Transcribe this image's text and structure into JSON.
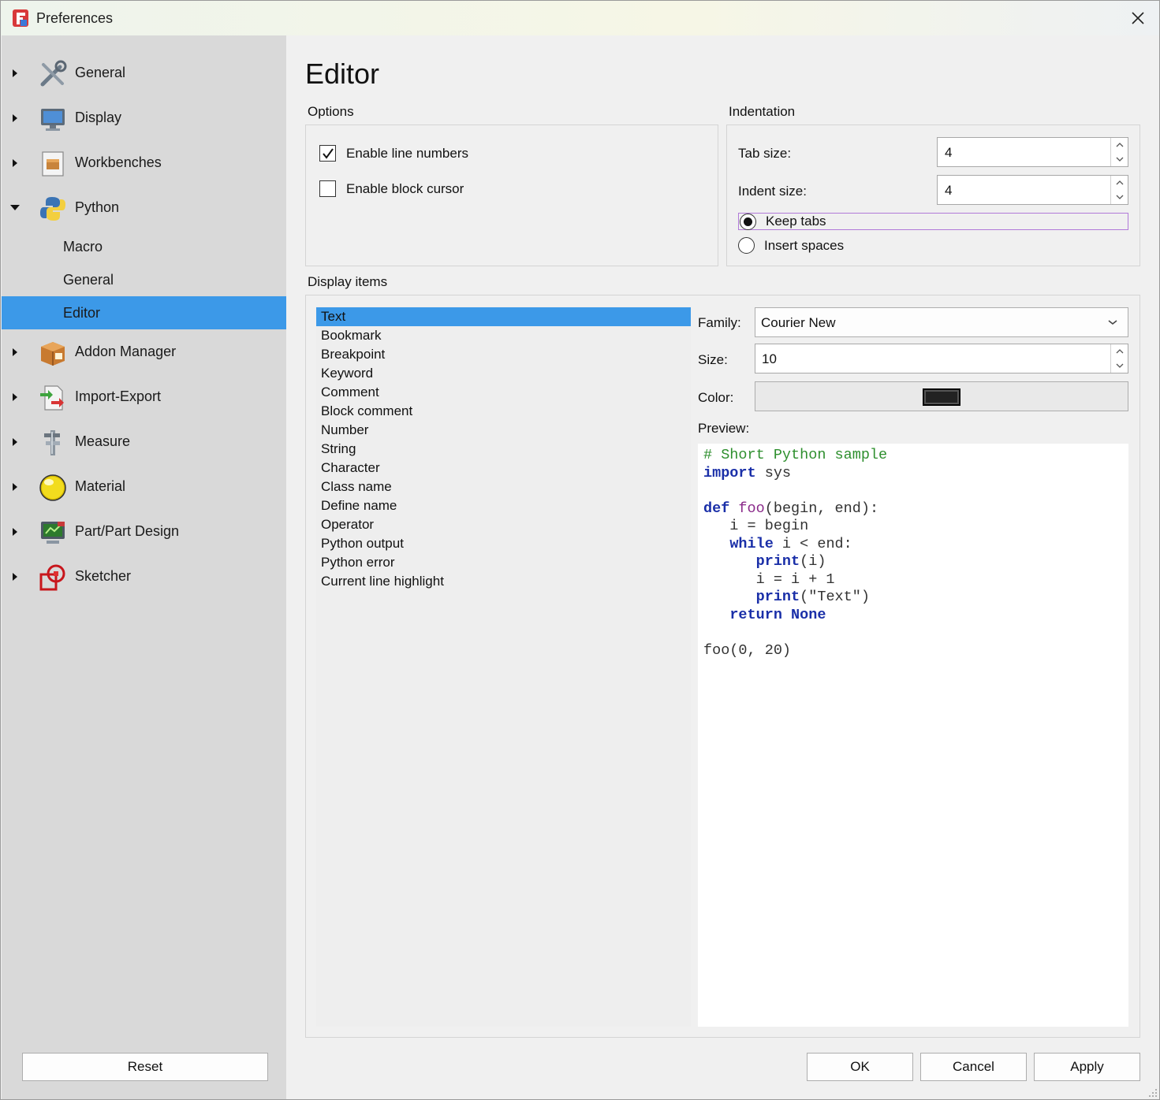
{
  "window": {
    "title": "Preferences"
  },
  "sidebar": {
    "items": [
      {
        "label": "General",
        "icon": "tools-icon"
      },
      {
        "label": "Display",
        "icon": "monitor-icon"
      },
      {
        "label": "Workbenches",
        "icon": "workbench-icon"
      },
      {
        "label": "Python",
        "icon": "python-icon",
        "expanded": true
      },
      {
        "label": "Addon Manager",
        "icon": "addon-box-icon"
      },
      {
        "label": "Import-Export",
        "icon": "import-export-icon"
      },
      {
        "label": "Measure",
        "icon": "caliper-icon"
      },
      {
        "label": "Material",
        "icon": "material-sphere-icon"
      },
      {
        "label": "Part/Part Design",
        "icon": "part-design-icon"
      },
      {
        "label": "Sketcher",
        "icon": "sketcher-icon"
      }
    ],
    "python_children": [
      {
        "label": "Macro"
      },
      {
        "label": "General"
      },
      {
        "label": "Editor",
        "selected": true
      }
    ],
    "reset_label": "Reset"
  },
  "page": {
    "title": "Editor",
    "options": {
      "group_label": "Options",
      "enable_line_numbers": {
        "label": "Enable line numbers",
        "checked": true
      },
      "enable_block_cursor": {
        "label": "Enable block cursor",
        "checked": false
      }
    },
    "indentation": {
      "group_label": "Indentation",
      "tab_size_label": "Tab size:",
      "tab_size": "4",
      "indent_size_label": "Indent size:",
      "indent_size": "4",
      "keep_tabs": {
        "label": "Keep tabs",
        "checked": true
      },
      "insert_spaces": {
        "label": "Insert spaces",
        "checked": false
      }
    },
    "display_items": {
      "group_label": "Display items",
      "items": [
        "Text",
        "Bookmark",
        "Breakpoint",
        "Keyword",
        "Comment",
        "Block comment",
        "Number",
        "String",
        "Character",
        "Class name",
        "Define name",
        "Operator",
        "Python output",
        "Python error",
        "Current line highlight"
      ],
      "selected": "Text",
      "family_label": "Family:",
      "family": "Courier New",
      "size_label": "Size:",
      "size": "10",
      "color_label": "Color:",
      "color": "#222222",
      "preview_label": "Preview:",
      "preview_code": {
        "l1": "# Short Python sample",
        "l2_kw": "import",
        "l2_rest": " sys",
        "l4_kw": "def",
        "l4_name": " foo",
        "l4_rest": "(begin, end):",
        "l5": "   i = begin",
        "l6_indent": "   ",
        "l6_kw": "while",
        "l6_rest": " i < end:",
        "l7_indent": "      ",
        "l7_kw": "print",
        "l7_rest": "(i)",
        "l8": "      i = i + 1",
        "l9_indent": "      ",
        "l9_kw": "print",
        "l9_rest": "(\"Text\")",
        "l10_indent": "   ",
        "l10_kw": "return",
        "l10_sp": " ",
        "l10_none": "None",
        "l12": "foo(0, 20)"
      }
    }
  },
  "buttons": {
    "ok": "OK",
    "cancel": "Cancel",
    "apply": "Apply"
  },
  "colors": {
    "selection": "#3c99e8",
    "sidebar_bg": "#d9d9d9",
    "comment": "#2e8f2e",
    "keyword": "#1a2fa8",
    "def_name": "#8a2a8a"
  }
}
